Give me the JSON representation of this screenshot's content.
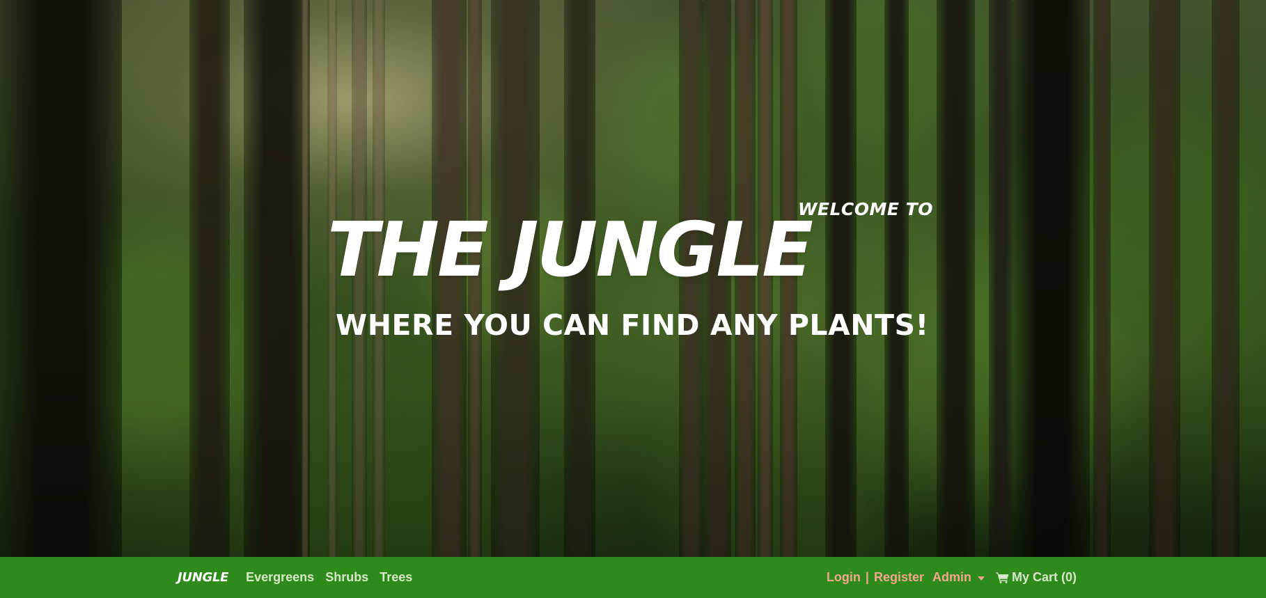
{
  "hero": {
    "welcome": "WELCOME TO",
    "title": "THE JUNGLE",
    "subtitle": "WHERE YOU CAN FIND ANY PLANTS!"
  },
  "navbar": {
    "brand": "JUNGLE",
    "links": [
      {
        "label": "Evergreens"
      },
      {
        "label": "Shrubs"
      },
      {
        "label": "Trees"
      }
    ],
    "login_label": "Login",
    "separator": "|",
    "register_label": "Register",
    "admin_label": "Admin",
    "cart_label": "My Cart",
    "cart_count": "(0)",
    "colors": {
      "bar": "#2e8b1b",
      "auth": "#f2a68b",
      "link": "#d6e8c8"
    }
  }
}
